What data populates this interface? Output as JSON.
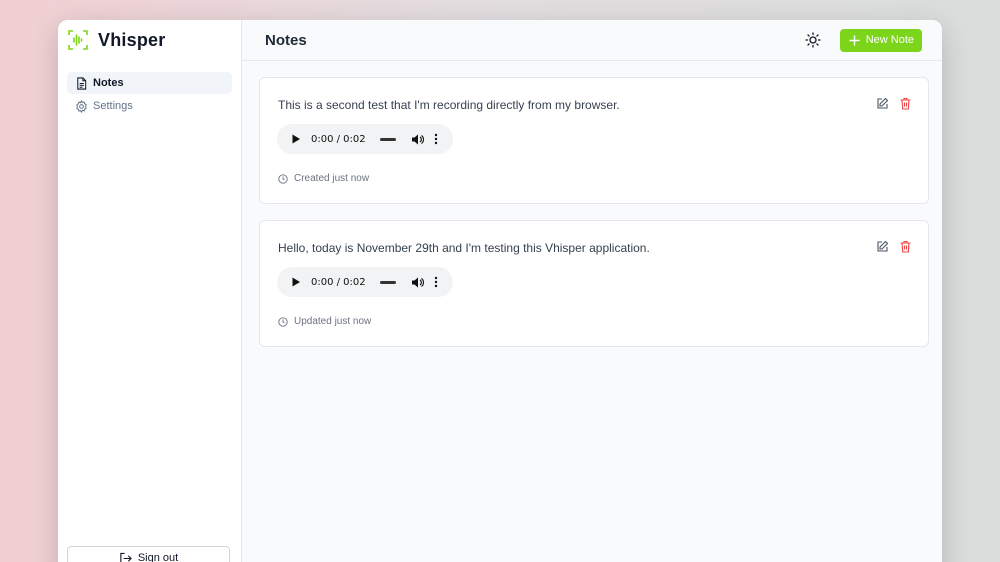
{
  "app": {
    "name": "Vhisper",
    "accent": "#7cd51a"
  },
  "sidebar": {
    "items": [
      {
        "label": "Notes",
        "icon": "file-text-icon",
        "active": true
      },
      {
        "label": "Settings",
        "icon": "gear-icon",
        "active": false
      }
    ],
    "signout_label": "Sign out"
  },
  "header": {
    "title": "Notes",
    "theme_icon": "sun-icon",
    "new_note_label": "New Note"
  },
  "notes": [
    {
      "text": "This is a second test that I'm recording directly from my browser.",
      "audio_time": "0:00 / 0:02",
      "meta": "Created just now"
    },
    {
      "text": "Hello, today is November 29th and I'm testing this Vhisper application.",
      "audio_time": "0:00 / 0:02",
      "meta": "Updated just now"
    }
  ],
  "colors": {
    "delete": "#ef4444",
    "edit": "#4b5563"
  }
}
